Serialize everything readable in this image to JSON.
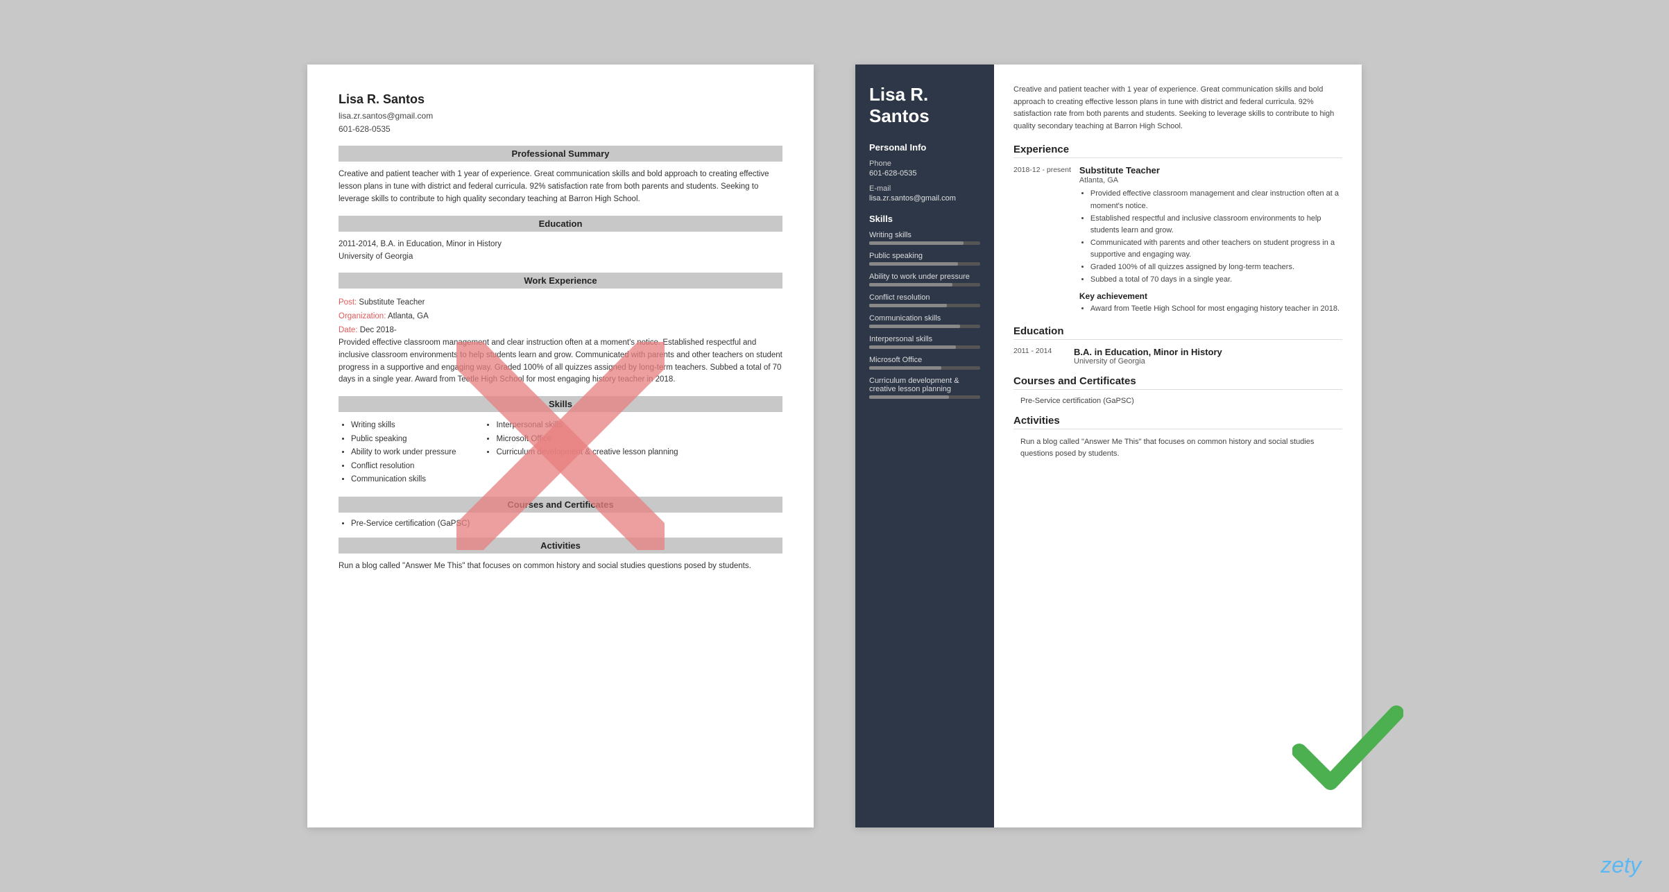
{
  "brand": {
    "name": "zety"
  },
  "left_resume": {
    "name": "Lisa R. Santos",
    "email": "lisa.zr.santos@gmail.com",
    "phone": "601-628-0535",
    "sections": {
      "professional_summary": {
        "title": "Professional Summary",
        "text": "Creative and patient teacher with 1 year of experience. Great communication skills and bold approach to creating effective lesson plans in tune with district and federal curricula. 92% satisfaction rate from both parents and students. Seeking to leverage skills to contribute to high quality secondary teaching at Barron High School."
      },
      "education": {
        "title": "Education",
        "entries": [
          {
            "years": "2011-2014",
            "degree": "B.A. in Education, Minor in History",
            "school": "University of Georgia"
          }
        ]
      },
      "work_experience": {
        "title": "Work Experience",
        "entries": [
          {
            "post_label": "Post:",
            "post": "Substitute Teacher",
            "org_label": "Organization:",
            "org": "Atlanta, GA",
            "date_label": "Date:",
            "date": "Dec 2018-",
            "description": "Provided effective classroom management and clear instruction often at a moment's notice. Established respectful and inclusive classroom environments to help students learn and grow. Communicated with parents and other teachers on student progress in a supportive and engaging way. Graded 100% of all quizzes assigned by long-term teachers. Subbed a total of 70 days in a single year. Award from Teetle High School for most engaging history teacher in 2018."
          }
        ]
      },
      "skills": {
        "title": "Skills",
        "left_col": [
          "Writing skills",
          "Public speaking",
          "Ability to work under pressure",
          "Conflict resolution",
          "Communication skills"
        ],
        "right_col": [
          "Interpersonal skills",
          "Microsoft Office",
          "Curriculum development & creative lesson planning"
        ]
      },
      "courses": {
        "title": "Courses and Certificates",
        "items": [
          "Pre-Service certification (GaPSC)"
        ]
      },
      "activities": {
        "title": "Activities",
        "text": "Run a blog called \"Answer Me This\" that focuses on common history and social studies questions posed by students."
      }
    }
  },
  "right_resume": {
    "sidebar": {
      "name": "Lisa R. Santos",
      "personal_info_title": "Personal Info",
      "phone_label": "Phone",
      "phone": "601-628-0535",
      "email_label": "E-mail",
      "email": "lisa.zr.santos@gmail.com",
      "skills_title": "Skills",
      "skills": [
        {
          "name": "Writing skills",
          "pct": 85
        },
        {
          "name": "Public speaking",
          "pct": 80
        },
        {
          "name": "Ability to work under pressure",
          "pct": 75
        },
        {
          "name": "Conflict resolution",
          "pct": 70
        },
        {
          "name": "Communication skills",
          "pct": 82
        },
        {
          "name": "Interpersonal skills",
          "pct": 78
        },
        {
          "name": "Microsoft Office",
          "pct": 65
        },
        {
          "name": "Curriculum development & creative lesson planning",
          "pct": 72
        }
      ]
    },
    "main": {
      "summary": "Creative and patient teacher with 1 year of experience. Great communication skills and bold approach to creating effective lesson plans in tune with district and federal curricula. 92% satisfaction rate from both parents and students. Seeking to leverage skills to contribute to high quality secondary teaching at Barron High School.",
      "experience_title": "Experience",
      "experience": [
        {
          "date": "2018-12 - present",
          "job_title": "Substitute Teacher",
          "location": "Atlanta, GA",
          "bullets": [
            "Provided effective classroom management and clear instruction often at a moment's notice.",
            "Established respectful and inclusive classroom environments to help students learn and grow.",
            "Communicated with parents and other teachers on student progress in a supportive and engaging way.",
            "Graded 100% of all quizzes assigned by long-term teachers.",
            "Subbed a total of 70 days in a single year."
          ],
          "achievement_title": "Key achievement",
          "achievement": "Award from Teetle High School for most engaging history teacher in 2018."
        }
      ],
      "education_title": "Education",
      "education": [
        {
          "date": "2011 - 2014",
          "degree": "B.A. in Education, Minor in History",
          "school": "University of Georgia"
        }
      ],
      "courses_title": "Courses and Certificates",
      "courses": [
        "Pre-Service certification (GaPSC)"
      ],
      "activities_title": "Activities",
      "activities_text": "Run a blog called \"Answer Me This\" that focuses on common history and social studies questions posed by students."
    }
  }
}
